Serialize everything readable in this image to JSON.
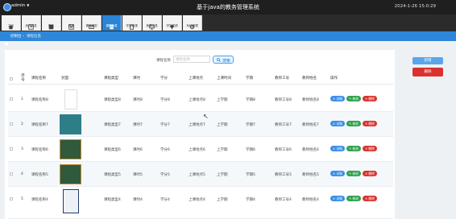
{
  "header": {
    "user": "admin",
    "title": "基于java的教务管理系统",
    "datetime": "2024-1-26 15:0:29"
  },
  "nav": [
    {
      "label": "主页",
      "icon": "home-icon"
    },
    {
      "label": "用户信息",
      "icon": "users-icon"
    },
    {
      "label": "学生",
      "icon": "student-icon"
    },
    {
      "label": "教师",
      "icon": "teacher-icon"
    },
    {
      "label": "课程类型",
      "icon": "tag-icon"
    },
    {
      "label": "课程信息",
      "icon": "book-icon"
    },
    {
      "label": "学生选课",
      "icon": "clipboard-icon"
    },
    {
      "label": "授课信息",
      "icon": "monitor-icon"
    },
    {
      "label": "学生成绩",
      "icon": "pin-icon"
    },
    {
      "label": "系统管理",
      "icon": "settings-icon"
    }
  ],
  "nav_active": 5,
  "breadcrumb": {
    "root": "控制台",
    "current": "课程信息"
  },
  "search": {
    "label": "课程名称",
    "placeholder": "课程名称",
    "button": "搜索"
  },
  "toolbar": {
    "add": "新增",
    "delete": "删除"
  },
  "table": {
    "columns": [
      "序号",
      "课程名称",
      "封面",
      "课程类型",
      "课时",
      "学分",
      "上课地点",
      "上课时间",
      "学期",
      "教师工号",
      "教师姓名",
      "操作"
    ],
    "rows": [
      {
        "index": "1",
        "name": "课程名称8",
        "type": "课程类型8",
        "hours": "课时8",
        "credit": "学分8",
        "place": "上课地点8",
        "time": "上学期",
        "term": "学期8",
        "tid": "教师工号8",
        "tname": "教师姓名8",
        "cover": "white"
      },
      {
        "index": "2",
        "name": "课程名称7",
        "type": "课程类型7",
        "hours": "课时7",
        "credit": "学分7",
        "place": "上课地点7",
        "time": "上学期",
        "term": "学期7",
        "tid": "教师工号7",
        "tname": "教师姓名7",
        "cover": "teal"
      },
      {
        "index": "3",
        "name": "课程名称6",
        "type": "课程类型6",
        "hours": "课时6",
        "credit": "学分6",
        "place": "上课地点6",
        "time": "上学期",
        "term": "学期6",
        "tid": "教师工号6",
        "tname": "教师姓名6",
        "cover": "dark-green"
      },
      {
        "index": "4",
        "name": "课程名称5",
        "type": "课程类型5",
        "hours": "课时5",
        "credit": "学分5",
        "place": "上课地点5",
        "time": "上学期",
        "term": "学期5",
        "tid": "教师工号5",
        "tname": "教师姓名5",
        "cover": "dark-green"
      },
      {
        "index": "5",
        "name": "课程名称4",
        "type": "课程类型4",
        "hours": "课时4",
        "credit": "学分4",
        "place": "上课地点4",
        "time": "上学期",
        "term": "学期4",
        "tid": "教师工号4",
        "tname": "教师姓名4",
        "cover": "navy"
      }
    ],
    "actions": {
      "view": "详情",
      "edit": "修改",
      "delete": "删除"
    }
  },
  "colors": {
    "topbar": "#1f1f1f",
    "accent": "#2a84d8",
    "danger": "#d9322e",
    "success": "#2fa14e"
  }
}
